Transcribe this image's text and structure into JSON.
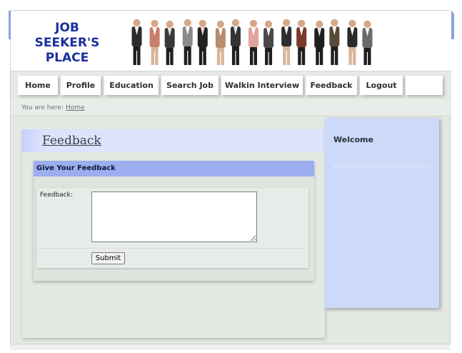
{
  "header": {
    "logo_lines": [
      "JOB",
      "SEEKER'S",
      "PLACE"
    ],
    "banner_icon": "people-group-image"
  },
  "nav": {
    "items": [
      {
        "label": "Home"
      },
      {
        "label": "Profile"
      },
      {
        "label": "Education"
      },
      {
        "label": "Search Job"
      },
      {
        "label": "Walkin Interview"
      },
      {
        "label": "Feedback"
      },
      {
        "label": "Logout"
      }
    ]
  },
  "breadcrumb": {
    "prefix": "You are here:",
    "link": "Home"
  },
  "main": {
    "page_title": "Feedback",
    "form": {
      "header": "Give Your Feedback",
      "feedback_label": "Feedback:",
      "feedback_value": "",
      "submit_label": "Submit"
    }
  },
  "sidebar": {
    "title": "Welcome"
  },
  "colors": {
    "logo_text": "#1a2f9c",
    "form_header": "#9caef0",
    "sidebar_bg": "#cdd9f8",
    "title_bar": "#dde3fd"
  }
}
